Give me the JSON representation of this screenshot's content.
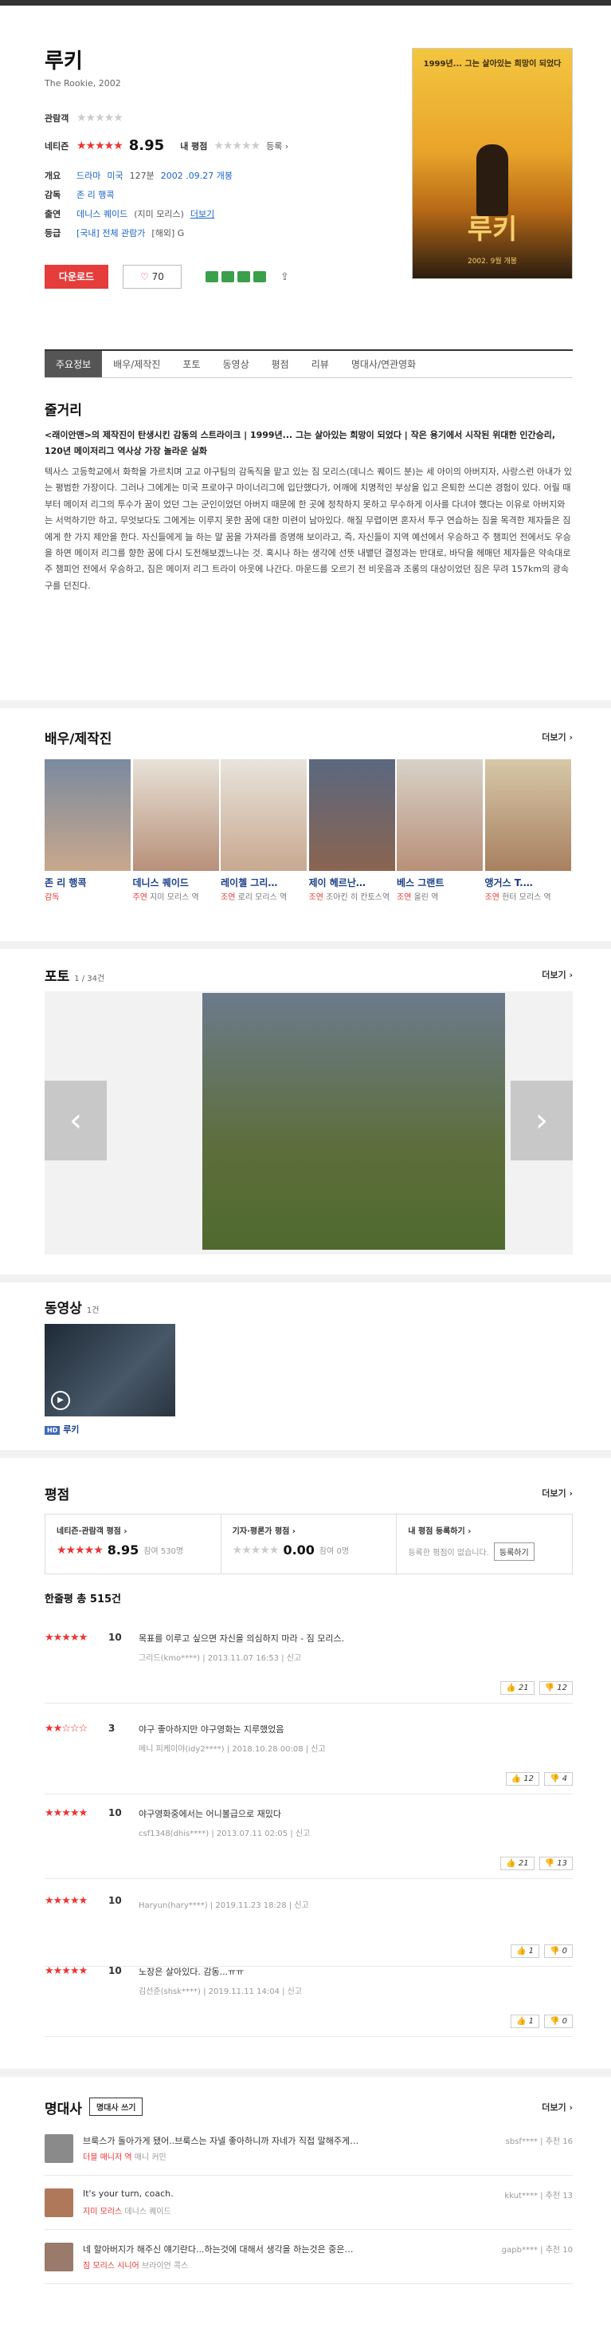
{
  "movie": {
    "title": "루키",
    "subtitle": "The Rookie, 2002",
    "poster": {
      "tagline": "1999년... 그는 살아있는 희망이 되었다",
      "title": "루키",
      "date": "2002. 9월 개봉"
    }
  },
  "ratings": {
    "audience_label": "관람객",
    "audience_stars": "★★★★★",
    "netizen_label": "네티즌",
    "netizen_stars": "★★★★★",
    "netizen_score": "8.95",
    "my_label": "내 평점",
    "my_stars": "★★★★★",
    "my_action": "등록 ›"
  },
  "info": {
    "overview_label": "개요",
    "genre": "드라마",
    "country": "미국",
    "runtime": "127분",
    "release": "2002 .09.27 개봉",
    "director_label": "감독",
    "director": "존 리 행콕",
    "cast_label": "출연",
    "cast": "데니스 퀘이드",
    "cast_role": "(지미 모리스)",
    "cast_more": "더보기",
    "grade_label": "등급",
    "grade": "[국내] 전체 관람가",
    "grade_overseas": "[해외] G"
  },
  "actions": {
    "download": "다운로드",
    "like_count": "70"
  },
  "tabs": [
    "주요정보",
    "배우/제작진",
    "포토",
    "동영상",
    "평점",
    "리뷰",
    "명대사/연관영화"
  ],
  "synopsis": {
    "title": "줄거리",
    "headline": "<래이안맨>의 제작진이 탄생시킨 감동의 스트라이크 | 1999년... 그는 살아있는 희망이 되었다 | 작은 용기에서 시작된 위대한 인간승리, 120년 메이저리그 역사상 가장 놀라운 실화",
    "body": "텍사스 고등학교에서 화학을 가르치며 고교 야구팀의 감독직을 맡고 있는 짐 모리스(데니스 퀘이드 분)는 세 아이의 아버지자, 사랑스런 아내가 있는 평범한 가장이다. 그러나 그에게는 미국 프로야구 마이너리그에 입단했다가, 어깨에 치명적인 부상을 입고 은퇴한 쓰디쓴 경험이 있다. 어릴 때부터 메이저 리그의 투수가 꿈이 었던 그는 군인이었던 아버지 때문에 한 곳에 정착하지 못하고 무수하게 이사를 다녀야 했다는 이유로 아버지와는 서먹하기만 하고, 무엇보다도 그에게는 이루지 못한 꿈에 대한 미련이 남아있다. 해질 무렵이면 혼자서 투구 연습하는 짐을 목격한 제자들은 짐에게 한 가지 제안을 한다. 자신들에게 늘 하는 말 꿈을 가져라를 증명해 보이라고, 즉, 자신들이 지역 예선에서 우승하고 주 챔피언 전에서도 우승을 하면 메이저 리그를 향한 꿈에 다시 도전해보겠느냐는 것. 혹시나 하는 생각에 선뜻 내뱉던 결정과는 반대로, 바닥을 헤매던 제자들은 약속대로 주 챔피언 전에서 우승하고, 짐은 메이저 리그 트라이 아웃에 나간다. 마운드를 오르기 전 비웃음과 조롱의 대상이었던 짐은 무려 157km의 광속구를 던진다."
  },
  "cast_section": {
    "title": "배우/제작진",
    "more": "더보기 ›",
    "people": [
      {
        "name": "존 리 행콕",
        "role": "감독",
        "char": ""
      },
      {
        "name": "데니스 퀘이드",
        "role": "주연",
        "char": "지미 모리스 역"
      },
      {
        "name": "레이첼 그리…",
        "role": "조연",
        "char": "로리 모리스 역"
      },
      {
        "name": "제이 헤르난…",
        "role": "조연",
        "char": "조아킨 히 칸토스역"
      },
      {
        "name": "베스 그랜트",
        "role": "조연",
        "char": "올린 역"
      },
      {
        "name": "앵거스 T.…",
        "role": "조연",
        "char": "헌터 모리스 역"
      }
    ]
  },
  "photo_section": {
    "title": "포토",
    "count": "1 / 34건",
    "more": "더보기 ›"
  },
  "video_section": {
    "title": "동영상",
    "count": "1건",
    "badge": "HD",
    "label": "루키"
  },
  "review_section": {
    "title": "평점",
    "more": "더보기 ›",
    "box": {
      "netizen": {
        "title": "네티즌·관람객 평점 ›",
        "stars": "★★★★★",
        "score": "8.95",
        "count": "참여 530명"
      },
      "critic": {
        "title": "기자·평론가 평점 ›",
        "stars": "★★★★★",
        "score": "0.00",
        "count": "참여 0명"
      },
      "mine": {
        "title": "내 평점 등록하기 ›",
        "desc": "등록한 평점이 없습니다.",
        "button": "등록하기"
      }
    },
    "total_label": "한줄평",
    "total": "총 515건",
    "reviews": [
      {
        "stars": "★★★★★",
        "score": "10",
        "text": "목표를 이루고 싶으면 자신을 의심하지 마라 - 짐 모리스.",
        "meta": "그리드(kmo****) | 2013.11.07 16:53 | 신고",
        "up": "21",
        "down": "12"
      },
      {
        "stars": "★★☆☆☆",
        "score": "3",
        "text": "야구 좋아하지만 야구영화는 지루했었음",
        "meta": "메니 피케이야(idy2****) | 2018.10.28 00:08 | 신고",
        "up": "12",
        "down": "4"
      },
      {
        "stars": "★★★★★",
        "score": "10",
        "text": "야구영화중에서는 어니볼급으로 재밌다",
        "meta": "csf1348(dhis****) | 2013.07.11 02:05 | 신고",
        "up": "21",
        "down": "13"
      },
      {
        "stars": "★★★★★",
        "score": "10",
        "text": "",
        "meta": "Haryun(hary****) | 2019.11.23 18:28 | 신고",
        "up": "1",
        "down": "0"
      },
      {
        "stars": "★★★★★",
        "score": "10",
        "text": "노장은 살아있다. 감동...ㅠㅠ",
        "meta": "김선준(shsk****) | 2019.11.11 14:04 | 신고",
        "up": "1",
        "down": "0"
      }
    ]
  },
  "quote_section": {
    "title": "명대사",
    "button": "명대사 쓰기",
    "more": "더보기 ›",
    "quotes": [
      {
        "text": "브룩스가 돌아가게 됐어..브룩스는 자넬 좋아하니까 자네가 직접 말해주게…",
        "actor": "더블 매니저 역",
        "actor2": "매니 커민",
        "user": "sbsf****",
        "rec": "추천 16"
      },
      {
        "text": "It's your turn, coach.",
        "actor": "지미 모리스",
        "actor2": "데니스 퀘이드",
        "user": "kkut****",
        "rec": "추천 13"
      },
      {
        "text": "네 할아버지가 해주신 얘기란다...하는것에 대해서 생각을 하는것은 중은…",
        "actor": "짐 모리스 시니어",
        "actor2": "브라이언 콕스",
        "user": "gapb****",
        "rec": "추천 10"
      }
    ]
  }
}
